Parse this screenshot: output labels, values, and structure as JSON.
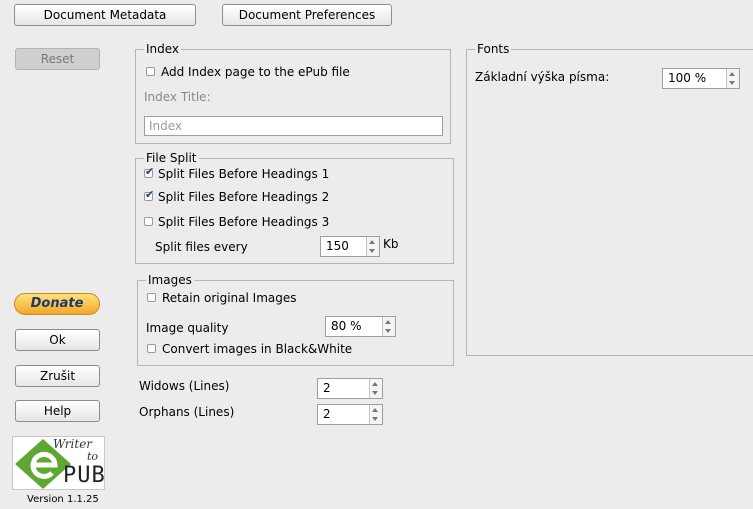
{
  "tabs": {
    "document_metadata": "Document Metadata",
    "document_preferences": "Document Preferences"
  },
  "left_panel": {
    "reset": "Reset",
    "donate": "Donate",
    "ok": "Ok",
    "cancel": "Zrušit",
    "help": "Help",
    "logo_text": {
      "writer": "Writer",
      "to": "to",
      "pub": "PUB"
    },
    "version": "Version 1.1.25"
  },
  "index_group": {
    "legend": "Index",
    "add_index_label": "Add Index page to the ePub file",
    "add_index_checked": false,
    "index_title_label": "Index Title:",
    "index_title_value": "",
    "index_title_placeholder": "Index"
  },
  "file_split_group": {
    "legend": "File Split",
    "h1_label": "Split Files Before Headings 1",
    "h1_checked": true,
    "h2_label": "Split Files Before Headings 2",
    "h2_checked": true,
    "h3_label": "Split Files Before Headings 3",
    "h3_checked": false,
    "split_every_label": "Split files every",
    "split_every_value": "150",
    "split_every_unit": "Kb"
  },
  "images_group": {
    "legend": "Images",
    "retain_label": "Retain original Images",
    "retain_checked": false,
    "quality_label": "Image quality",
    "quality_value": "80 %",
    "bw_label": "Convert images in Black&White",
    "bw_checked": false
  },
  "widows": {
    "label": "Widows (Lines)",
    "value": "2"
  },
  "orphans": {
    "label": "Orphans (Lines)",
    "value": "2"
  },
  "fonts_group": {
    "legend": "Fonts",
    "base_size_label": "Základní výška písma:",
    "base_size_value": "100 %"
  },
  "colors": {
    "donate_gradient_top": "#ffe27a",
    "donate_gradient_bottom": "#f2a62a",
    "logo_green": "#5ea832",
    "checkmark": "#1f3f8f"
  }
}
